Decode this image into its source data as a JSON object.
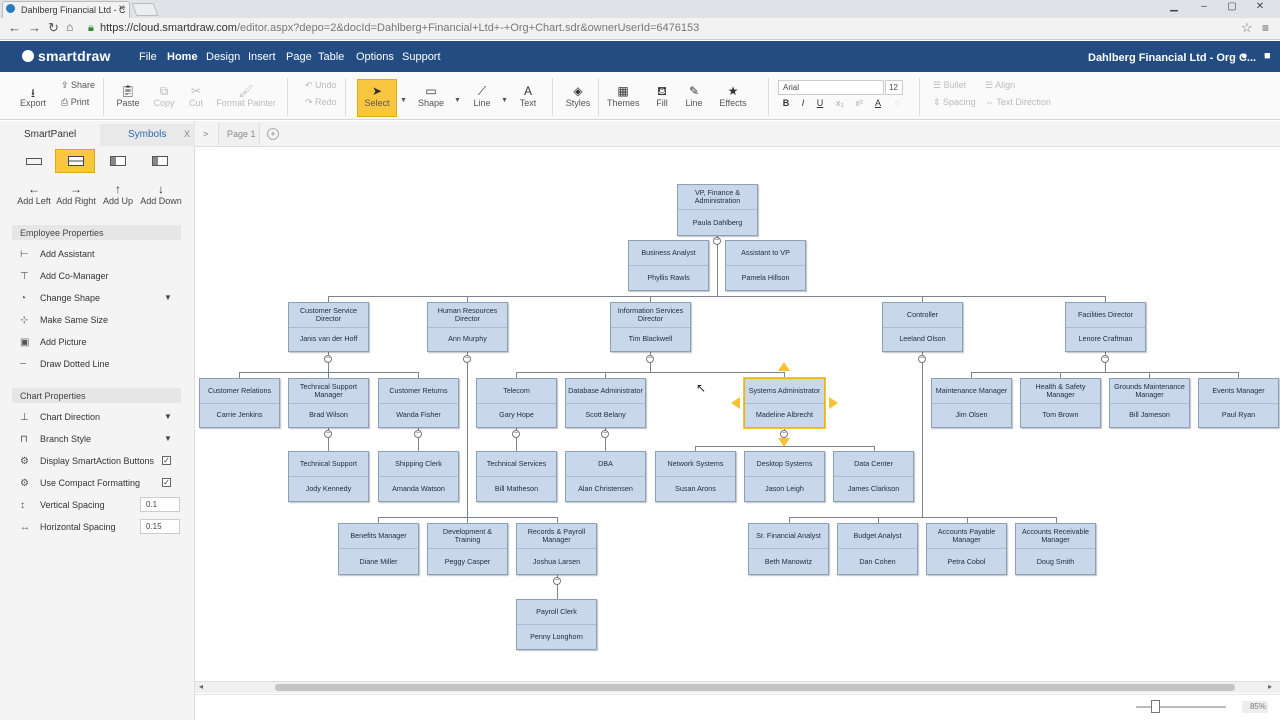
{
  "browser": {
    "tab_title": "Dahlberg Financial Ltd - C",
    "url_host": "https://cloud.smartdraw.com",
    "url_path": "/editor.aspx?depo=2&docId=Dahlberg+Financial+Ltd+-+Org+Chart.sdr&ownerUserId=6476153"
  },
  "app": {
    "logo": "smartdraw",
    "menu": [
      "File",
      "Home",
      "Design",
      "Insert",
      "Page",
      "Table",
      "Options",
      "Support"
    ],
    "active_menu": "Home",
    "doc_title": "Dahlberg Financial Ltd - Org C..."
  },
  "ribbon": {
    "export": "Export",
    "share": "Share",
    "print": "Print",
    "paste": "Paste",
    "copy": "Copy",
    "cut": "Cut",
    "format_painter": "Format Painter",
    "undo": "Undo",
    "redo": "Redo",
    "select": "Select",
    "shape": "Shape",
    "line": "Line",
    "text": "Text",
    "styles": "Styles",
    "themes": "Themes",
    "fill": "Fill",
    "line2": "Line",
    "effects": "Effects",
    "font": "Arial",
    "font_size": "12",
    "bullet": "Bullet",
    "align": "Align",
    "spacing": "Spacing",
    "text_direction": "Text Direction"
  },
  "left_panel": {
    "tab_smartpanel": "SmartPanel",
    "tab_symbols": "Symbols",
    "add_left": "Add Left",
    "add_right": "Add Right",
    "add_up": "Add Up",
    "add_down": "Add Down",
    "employee_header": "Employee Properties",
    "employee_items": [
      "Add Assistant",
      "Add Co-Manager",
      "Change Shape",
      "Make Same Size",
      "Add Picture",
      "Draw Dotted Line"
    ],
    "chart_header": "Chart Properties",
    "chart_items": [
      "Chart Direction",
      "Branch Style",
      "Display SmartAction Buttons",
      "Use Compact Formatting",
      "Vertical Spacing",
      "Horizontal Spacing"
    ],
    "vertical_spacing": "0.1",
    "horizontal_spacing": "0.15"
  },
  "page_tab": "Page 1",
  "zoom": "85%",
  "org": {
    "ceo": {
      "title": "VP, Finance & Administration",
      "name": "Paula Dahlberg"
    },
    "analyst": {
      "title": "Business Analyst",
      "name": "Phyllis Rawls"
    },
    "assistant": {
      "title": "Assistant to VP",
      "name": "Pamela Hillson"
    },
    "cs_dir": {
      "title": "Customer Service Director",
      "name": "Janis van der Hoff"
    },
    "hr_dir": {
      "title": "Human Resources Director",
      "name": "Ann Murphy"
    },
    "is_dir": {
      "title": "Information Services Director",
      "name": "Tim Blackwell"
    },
    "controller": {
      "title": "Controller",
      "name": "Leeland Olson"
    },
    "facilities": {
      "title": "Facilities Director",
      "name": "Lenore Craftman"
    },
    "cust_rel": {
      "title": "Customer Relations",
      "name": "Carrie Jenkins"
    },
    "tech_sup_mgr": {
      "title": "Technical Support Manager",
      "name": "Brad Wilson"
    },
    "cust_ret": {
      "title": "Customer Returns",
      "name": "Wanda Fisher"
    },
    "telecom": {
      "title": "Telecom",
      "name": "Gary Hope"
    },
    "db_admin": {
      "title": "Database Administrator",
      "name": "Scott Belany"
    },
    "sys_admin": {
      "title": "Systems Administrator",
      "name": "Madeline Albrecht"
    },
    "maint_mgr": {
      "title": "Maintenance Manager",
      "name": "Jim Olsen"
    },
    "hs_mgr": {
      "title": "Health & Safety Manager",
      "name": "Tom Brown"
    },
    "grounds_mgr": {
      "title": "Grounds Maintenance Manager",
      "name": "Bill Jameson"
    },
    "events_mgr": {
      "title": "Events Manager",
      "name": "Paul Ryan"
    },
    "tech_sup": {
      "title": "Technical Support",
      "name": "Jody Kennedy"
    },
    "ship_clerk": {
      "title": "Shipping Clerk",
      "name": "Amanda Watson"
    },
    "tech_svc": {
      "title": "Technical Services",
      "name": "Bill Matheson"
    },
    "dba": {
      "title": "DBA",
      "name": "Alan Christensen"
    },
    "net_sys": {
      "title": "Network Systems",
      "name": "Susan Arons"
    },
    "desk_sys": {
      "title": "Desktop Systems",
      "name": "Jason Leigh"
    },
    "data_ctr": {
      "title": "Data Center",
      "name": "James Clarkson"
    },
    "ben_mgr": {
      "title": "Benefits Manager",
      "name": "Diane Miller"
    },
    "dev_train": {
      "title": "Development & Training",
      "name": "Peggy Casper"
    },
    "rec_pay": {
      "title": "Records & Payroll Manager",
      "name": "Joshua Larsen"
    },
    "payroll": {
      "title": "Payroll Clerk",
      "name": "Penny Longhorn"
    },
    "sr_fin": {
      "title": "Sr. Financial Analyst",
      "name": "Beth Manowitz"
    },
    "budget": {
      "title": "Budget Analyst",
      "name": "Dan Cohen"
    },
    "ap_mgr": {
      "title": "Accounts Payable Manager",
      "name": "Petra Cobol"
    },
    "ar_mgr": {
      "title": "Accounts Receivable Manager",
      "name": "Doug Smith"
    }
  }
}
